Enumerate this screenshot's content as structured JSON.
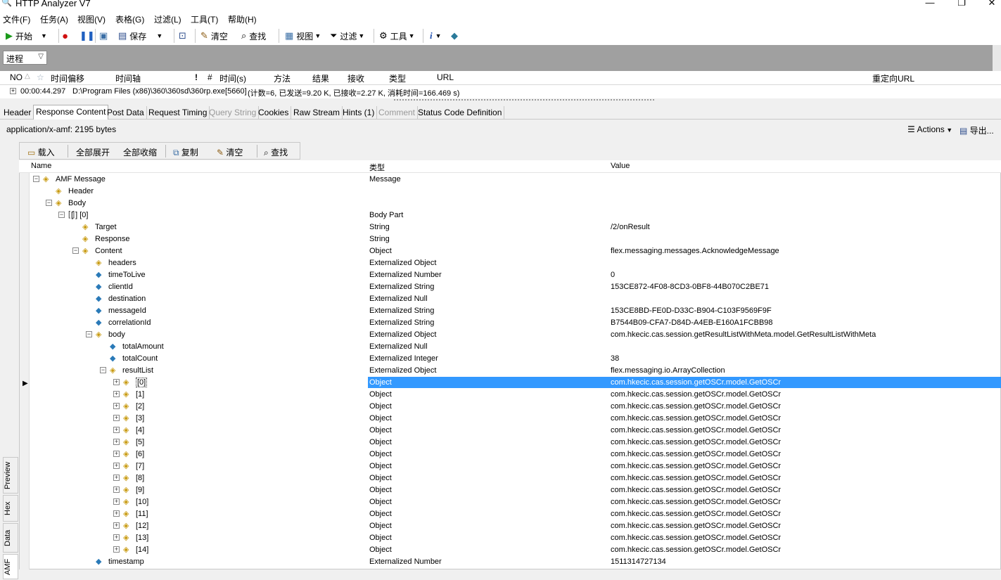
{
  "window": {
    "title": "HTTP Analyzer V7"
  },
  "menu": [
    "文件(F)",
    "任务(A)",
    "视图(V)",
    "表格(G)",
    "过滤(L)",
    "工具(T)",
    "帮助(H)"
  ],
  "toolbar": {
    "start": "开始",
    "save": "保存",
    "clear": "清空",
    "find": "查找",
    "view": "视图",
    "filter": "过滤",
    "tools": "工具"
  },
  "process_filter": "进程",
  "session_columns": [
    "NO",
    "时间偏移",
    "时间轴",
    "!",
    "#",
    "时间(s)",
    "方法",
    "结果",
    "接收",
    "类型",
    "URL",
    "重定向URL"
  ],
  "session_row": {
    "time": "00:00:44.297",
    "process": "D:\\Program Files (x86)\\360\\360sd\\360rp.exe[5660]",
    "summary": "(计数=6, 已发送=9.20 K, 已接收=2.27 K, 消耗时间=166.469 s)"
  },
  "tabs": [
    "Header",
    "Response Content",
    "Post Data",
    "Request Timing",
    "Query String",
    "Cookies",
    "Raw Stream",
    "Hints (1)",
    "Comment",
    "Status Code Definition"
  ],
  "content": {
    "type_info": "application/x-amf: 2195 bytes",
    "actions": "Actions",
    "export": "导出..."
  },
  "amf_toolbar": {
    "load": "载入",
    "expand_all": "全部展开",
    "collapse_all": "全部收缩",
    "copy": "复制",
    "clear": "清空",
    "find": "查找"
  },
  "tree_columns": {
    "name": "Name",
    "type": "类型",
    "value": "Value"
  },
  "tree_rows": [
    {
      "name": "AMF Message",
      "type": "Message",
      "value": ""
    },
    {
      "name": "Header",
      "type": "",
      "value": ""
    },
    {
      "name": "Body",
      "type": "",
      "value": ""
    },
    {
      "name": "[ ]  [0]",
      "type": "Body Part",
      "value": ""
    },
    {
      "name": "Target",
      "type": "String",
      "value": "/2/onResult"
    },
    {
      "name": "Response",
      "type": "String",
      "value": ""
    },
    {
      "name": "Content",
      "type": "Object",
      "value": "flex.messaging.messages.AcknowledgeMessage"
    },
    {
      "name": "headers",
      "type": "Externalized Object",
      "value": ""
    },
    {
      "name": "timeToLive",
      "type": "Externalized Number",
      "value": "0"
    },
    {
      "name": "clientId",
      "type": "Externalized String",
      "value": "153CE872-4F08-8CD3-0BF8-44B070C2BE71"
    },
    {
      "name": "destination",
      "type": "Externalized Null",
      "value": ""
    },
    {
      "name": "messageId",
      "type": "Externalized String",
      "value": "153CE8BD-FE0D-D33C-B904-C103F9569F9F"
    },
    {
      "name": "correlationId",
      "type": "Externalized String",
      "value": "B7544B09-CFA7-D84D-A4EB-E160A1FCBB98"
    },
    {
      "name": "body",
      "type": "Externalized Object",
      "value": "com.hkecic.cas.session.getResultListWithMeta.model.GetResultListWithMeta"
    },
    {
      "name": "totalAmount",
      "type": "Externalized Null",
      "value": ""
    },
    {
      "name": "totalCount",
      "type": "Externalized Integer",
      "value": "38"
    },
    {
      "name": "resultList",
      "type": "Externalized Object",
      "value": "flex.messaging.io.ArrayCollection"
    },
    {
      "name": "[0]",
      "type": "Object",
      "value": "com.hkecic.cas.session.getOSCr.model.GetOSCr"
    },
    {
      "name": "[1]",
      "type": "Object",
      "value": "com.hkecic.cas.session.getOSCr.model.GetOSCr"
    },
    {
      "name": "[2]",
      "type": "Object",
      "value": "com.hkecic.cas.session.getOSCr.model.GetOSCr"
    },
    {
      "name": "[3]",
      "type": "Object",
      "value": "com.hkecic.cas.session.getOSCr.model.GetOSCr"
    },
    {
      "name": "[4]",
      "type": "Object",
      "value": "com.hkecic.cas.session.getOSCr.model.GetOSCr"
    },
    {
      "name": "[5]",
      "type": "Object",
      "value": "com.hkecic.cas.session.getOSCr.model.GetOSCr"
    },
    {
      "name": "[6]",
      "type": "Object",
      "value": "com.hkecic.cas.session.getOSCr.model.GetOSCr"
    },
    {
      "name": "[7]",
      "type": "Object",
      "value": "com.hkecic.cas.session.getOSCr.model.GetOSCr"
    },
    {
      "name": "[8]",
      "type": "Object",
      "value": "com.hkecic.cas.session.getOSCr.model.GetOSCr"
    },
    {
      "name": "[9]",
      "type": "Object",
      "value": "com.hkecic.cas.session.getOSCr.model.GetOSCr"
    },
    {
      "name": "[10]",
      "type": "Object",
      "value": "com.hkecic.cas.session.getOSCr.model.GetOSCr"
    },
    {
      "name": "[11]",
      "type": "Object",
      "value": "com.hkecic.cas.session.getOSCr.model.GetOSCr"
    },
    {
      "name": "[12]",
      "type": "Object",
      "value": "com.hkecic.cas.session.getOSCr.model.GetOSCr"
    },
    {
      "name": "[13]",
      "type": "Object",
      "value": "com.hkecic.cas.session.getOSCr.model.GetOSCr"
    },
    {
      "name": "[14]",
      "type": "Object",
      "value": "com.hkecic.cas.session.getOSCr.model.GetOSCr"
    },
    {
      "name": "timestamp",
      "type": "Externalized Number",
      "value": "1511314727134"
    }
  ],
  "side_tabs": [
    "Preview",
    "Hex",
    "Data",
    "AMF"
  ]
}
